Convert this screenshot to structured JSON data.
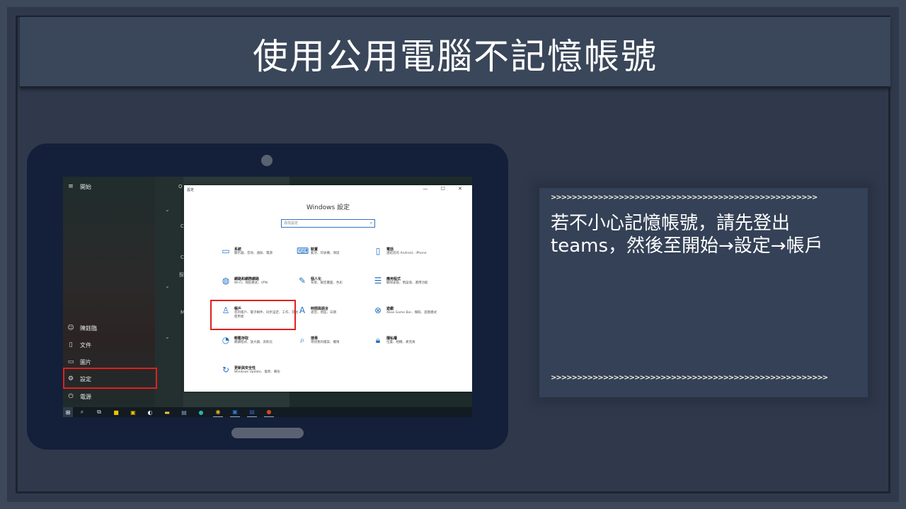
{
  "slide": {
    "title": "使用公用電腦不記憶帳號",
    "instruction": "若不小心記憶帳號，請先登出teams，然後至開始→設定→帳戶",
    "arrows_top": ">>>>>>>>>>>>>>>>>>>>>>>>>>>>>>>>>>>>>>>>>>>>>>>>>>>",
    "arrows_bottom": ">>>>>>>>>>>>>>>>>>>>>>>>>>>>>>>>>>>>>>>>>>>>>>>>>>>>>"
  },
  "start_menu": {
    "header": "開始",
    "tile_label_o": "O",
    "tile_label_c1": "C",
    "tile_label_c2": "C",
    "tile_label_find": "探",
    "tile_label_m": "M",
    "items": [
      {
        "label": "陳鈺臨",
        "icon": "user-icon"
      },
      {
        "label": "文件",
        "icon": "document-icon"
      },
      {
        "label": "圖片",
        "icon": "picture-icon"
      },
      {
        "label": "設定",
        "icon": "gear-icon"
      },
      {
        "label": "電源",
        "icon": "power-icon"
      }
    ]
  },
  "settings_window": {
    "window_title": "設定",
    "controls": "— ☐ ✕",
    "heading": "Windows 設定",
    "search_placeholder": "尋找設定",
    "categories": [
      {
        "name": "系統",
        "desc": "顯示器、音效、通知、電源",
        "icon": "laptop-icon"
      },
      {
        "name": "裝置",
        "desc": "藍牙、印表機、滑鼠",
        "icon": "devices-icon"
      },
      {
        "name": "電話",
        "desc": "連結您的 Android、iPhone",
        "icon": "phone-icon"
      },
      {
        "name": "網路和網際網路",
        "desc": "Wi-Fi、飛航模式、VPN",
        "icon": "globe-icon"
      },
      {
        "name": "個人化",
        "desc": "背景、鎖定畫面、色彩",
        "icon": "personalization-icon"
      },
      {
        "name": "應用程式",
        "desc": "解除安裝、預設值、選用功能",
        "icon": "apps-icon"
      },
      {
        "name": "帳戶",
        "desc": "您的帳戶、電子郵件、同步設定、工作、其他使用者",
        "icon": "account-icon"
      },
      {
        "name": "時間與語言",
        "desc": "語音、地區、日期",
        "icon": "time-language-icon"
      },
      {
        "name": "遊戲",
        "desc": "Xbox Game Bar、擷取、遊戲模式",
        "icon": "xbox-icon"
      },
      {
        "name": "輕鬆存取",
        "desc": "朗讀程式、放大鏡、高對比",
        "icon": "ease-of-access-icon"
      },
      {
        "name": "搜尋",
        "desc": "尋找我的檔案、權限",
        "icon": "search-icon"
      },
      {
        "name": "隱私權",
        "desc": "位置、相機、麥克風",
        "icon": "lock-icon"
      },
      {
        "name": "更新與安全性",
        "desc": "Windows Update、復原、備份",
        "icon": "update-icon"
      }
    ]
  },
  "taskbar": {
    "icons": [
      "windows-start-icon",
      "search-icon",
      "task-view-icon",
      "sticky-notes-icon",
      "store-icon",
      "paint-icon",
      "file-explorer-icon",
      "calculator-icon",
      "edge-icon",
      "chrome-icon",
      "outlook-icon",
      "word-icon",
      "powerpoint-icon"
    ]
  },
  "colors": {
    "accent": "#1f6fc5",
    "highlight": "#e02020",
    "background": "#2f394b"
  }
}
